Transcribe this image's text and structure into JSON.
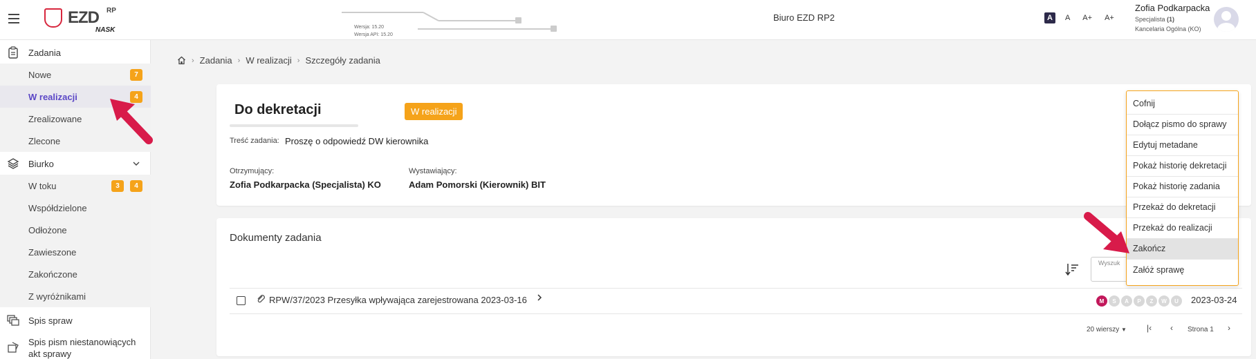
{
  "header": {
    "logo_text": "EZD",
    "logo_sup": "RP",
    "logo_sub": "NASK",
    "version_line1": "Wersja: 15.20",
    "version_line2": "Wersja API: 15.20",
    "office": "Biuro EZD RP2",
    "font_sizes": [
      "A",
      "A",
      "A+",
      "A+"
    ],
    "user_name": "Zofia Podkarpacka",
    "user_role_prefix": "Specjalista ",
    "user_role_count": "(1)",
    "user_dept": "Kancelaria Ogólna (KO)"
  },
  "sidebar": {
    "zadania": "Zadania",
    "nowe": "Nowe",
    "nowe_badge": "7",
    "w_realizacji": "W realizacji",
    "w_realizacji_badge": "4",
    "zrealizowane": "Zrealizowane",
    "zlecone": "Zlecone",
    "biurko": "Biurko",
    "w_toku": "W toku",
    "w_toku_badge1": "3",
    "w_toku_badge2": "4",
    "wspoldzielone": "Współdzielone",
    "odlozone": "Odłożone",
    "zawieszone": "Zawieszone",
    "zakonczone": "Zakończone",
    "z_wyroznikami": "Z wyróżnikami",
    "spis_spraw": "Spis spraw",
    "spis_pism": "Spis pism niestanowiących",
    "spis_pism2": "akt sprawy"
  },
  "breadcrumb": [
    "Zadania",
    "W realizacji",
    "Szczegóły zadania"
  ],
  "task": {
    "title": "Do dekretacji",
    "status": "W realizacji",
    "content_label": "Treść zadania:",
    "content_value": "Proszę o odpowiedź DW kierownika",
    "recipient_label": "Otrzymujący:",
    "recipient_value": "Zofia Podkarpacka (Specjalista) KO",
    "issuer_label": "Wystawiający:",
    "issuer_value": "Adam Pomorski (Kierownik) BIT"
  },
  "documents": {
    "title": "Dokumenty zadania",
    "search_placeholder": "Wyszuk",
    "row_text": "RPW/37/2023 Przesyłka wpływająca zarejestrowana 2023-03-16",
    "stages": [
      "M",
      "S",
      "A",
      "P",
      "Z",
      "W",
      "U"
    ],
    "row_date": "2023-03-24",
    "per_page": "20 wierszy",
    "page_label": "Strona 1"
  },
  "menu": {
    "items": [
      "Cofnij",
      "Dołącz pismo do sprawy",
      "Edytuj metadane",
      "Pokaż historię dekretacji",
      "Pokaż historię zadania",
      "Przekaż do dekretacji",
      "Przekaż do realizacji",
      "Zakończ",
      "Załóż sprawę"
    ]
  },
  "colors": {
    "accent_orange": "#f5a31a",
    "brand_red": "#d7263d",
    "active_purple": "#5b47c6",
    "arrow_red": "#d81b4a"
  }
}
